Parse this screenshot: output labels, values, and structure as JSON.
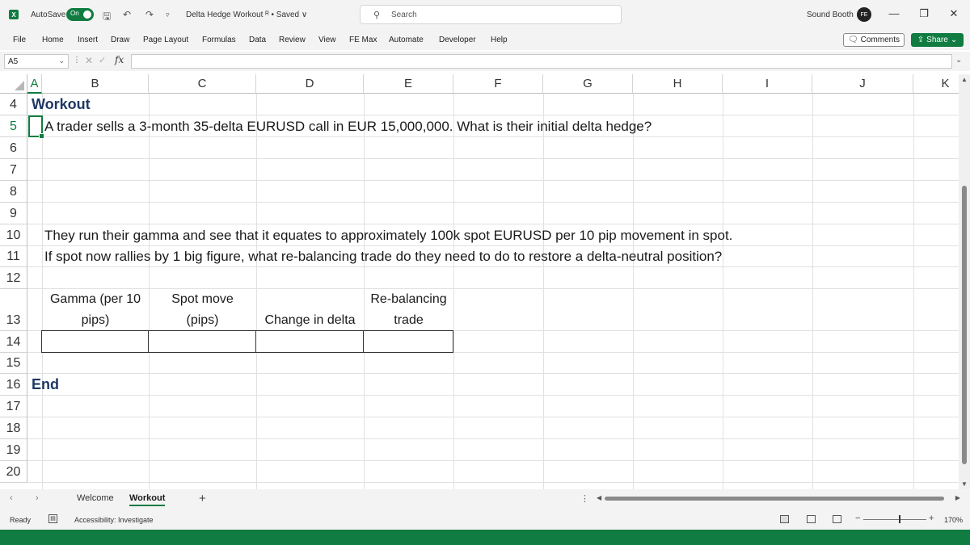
{
  "titlebar": {
    "app_icon": "X",
    "autosave_label": "AutoSave",
    "autosave_state": "On",
    "doc_title": "Delta Hedge Workout ᴿ • Saved ∨",
    "search_placeholder": "Search",
    "user_name": "Sound Booth",
    "user_initials": "FE",
    "icons": [
      "save-icon",
      "undo-icon",
      "redo-icon",
      "customize-icon"
    ]
  },
  "menu": {
    "items": [
      "File",
      "Home",
      "Insert",
      "Draw",
      "Page Layout",
      "Formulas",
      "Data",
      "Review",
      "View",
      "FE Max",
      "Automate",
      "Developer",
      "Help"
    ],
    "comments_label": "Comments",
    "share_label": "Share"
  },
  "formula_bar": {
    "name_box": "A5",
    "fx_label": "fx",
    "formula_value": ""
  },
  "grid": {
    "columns": [
      "A",
      "B",
      "C",
      "D",
      "E",
      "F",
      "G",
      "H",
      "I",
      "J",
      "K"
    ],
    "rows": [
      "4",
      "5",
      "6",
      "7",
      "8",
      "9",
      "10",
      "11",
      "12",
      "13",
      "14",
      "15",
      "16",
      "17",
      "18",
      "19",
      "20"
    ],
    "active_cell": "A5"
  },
  "content": {
    "heading_workout": "Workout",
    "question_1": "A trader sells a 3-month 35-delta EURUSD call in EUR 15,000,000. What is their initial delta hedge?",
    "question_2a": "They run their gamma and see that it equates to approximately 100k spot EURUSD per 10 pip movement in spot.",
    "question_2b": "If spot now rallies by 1 big figure, what re-balancing trade do they need to do to restore a delta-neutral position?",
    "table_headers": {
      "gamma_line1": "Gamma (per 10",
      "gamma_line2": "pips)",
      "spot_line1": "Spot move",
      "spot_line2": "(pips)",
      "change_delta": "Change in delta",
      "rebal_line1": "Re-balancing",
      "rebal_line2": "trade"
    },
    "heading_end": "End"
  },
  "sheets": {
    "tabs": [
      "Welcome",
      "Workout"
    ],
    "active": "Workout",
    "add_label": "+"
  },
  "status": {
    "ready": "Ready",
    "accessibility": "Accessibility: Investigate",
    "zoom": "170%"
  },
  "colors": {
    "accent": "#107c41",
    "heading": "#1f3864"
  }
}
